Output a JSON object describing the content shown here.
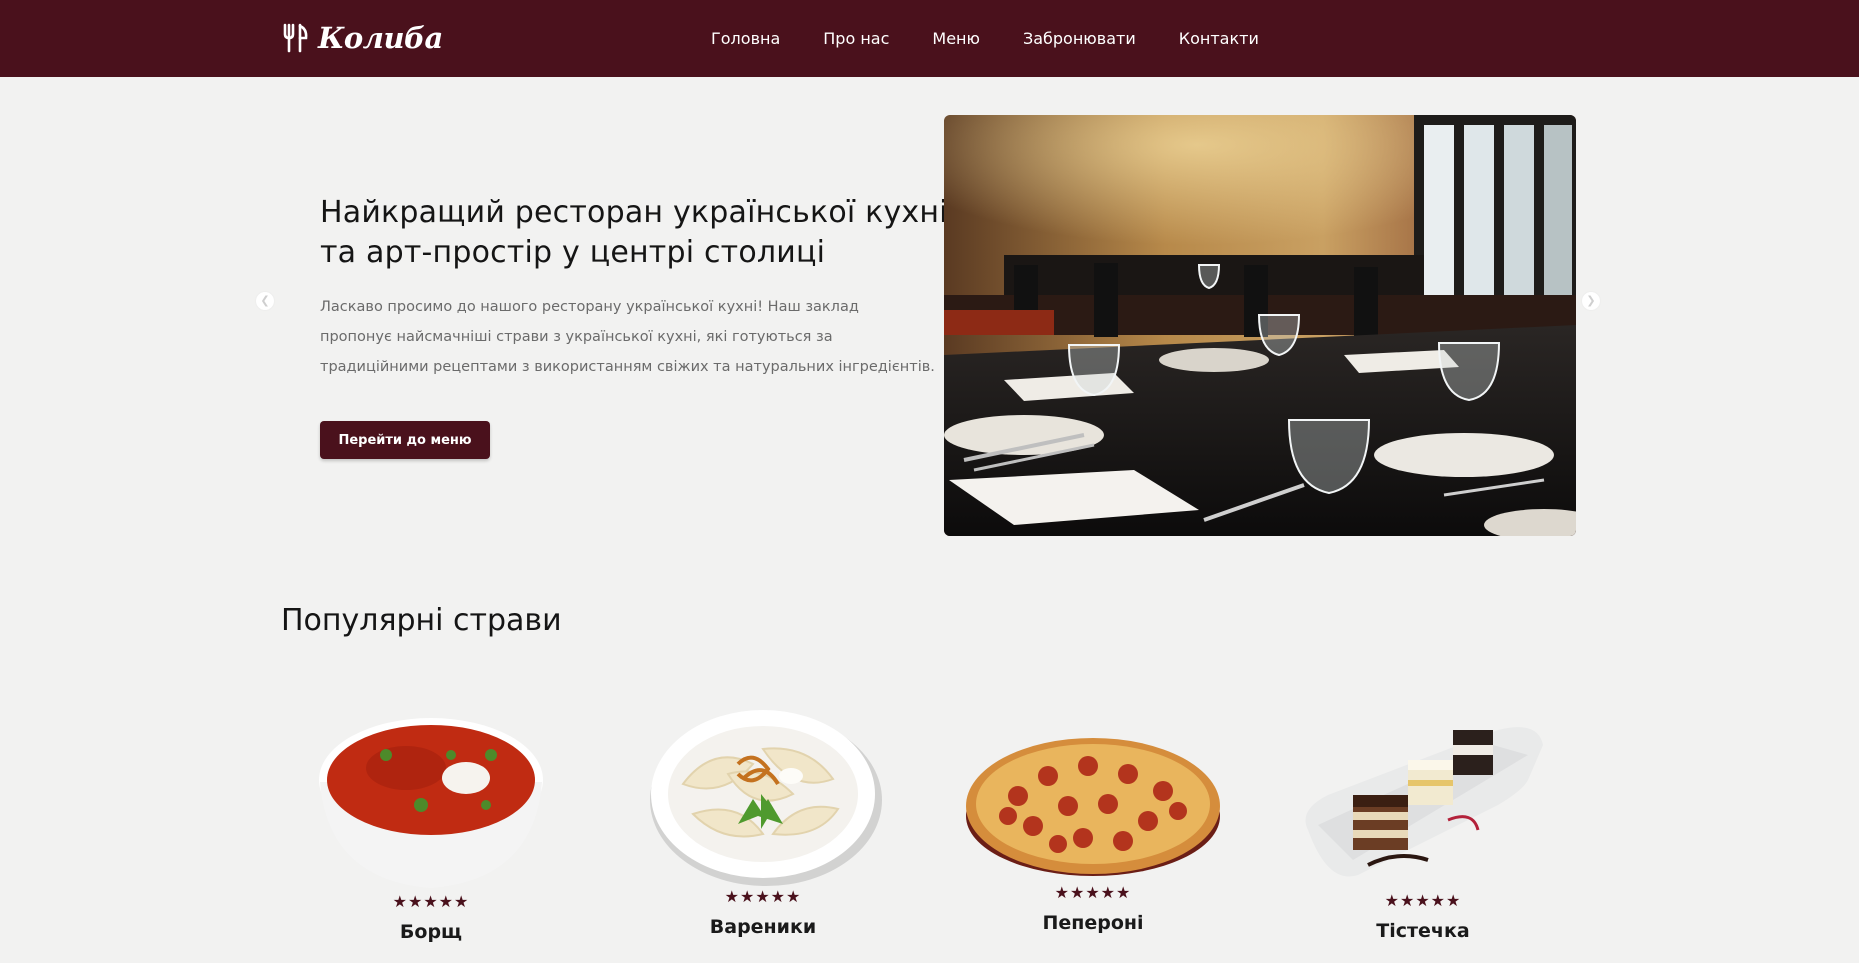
{
  "brand": {
    "name": "Колиба",
    "logo_icon": "fork-knife-icon",
    "primary_color": "#4a111c",
    "background_color": "#f2f2f1"
  },
  "nav": {
    "items": [
      {
        "label": "Головна"
      },
      {
        "label": "Про нас"
      },
      {
        "label": "Меню"
      },
      {
        "label": "Забронювати"
      },
      {
        "label": "Контакти"
      }
    ]
  },
  "hero": {
    "title_line1": "Найкращий ресторан української кухні",
    "title_line2": "та арт-простір у центрі столиці",
    "desc_line1": "Ласкаво просимо до нашого ресторану української кухні! Наш заклад",
    "desc_line2": "пропонує найсмачніші страви з української кухні, які готуються за",
    "desc_line3": "традиційними рецептами з використанням свіжих та натуральних інгредієнтів.",
    "cta_label": "Перейти до меню",
    "prev_icon": "chevron-left-icon",
    "next_icon": "chevron-right-icon"
  },
  "popular": {
    "title": "Популярні страви",
    "dishes": [
      {
        "name": "Борщ",
        "rating": 5,
        "stars": "★★★★★"
      },
      {
        "name": "Вареники",
        "rating": 5,
        "stars": "★★★★★"
      },
      {
        "name": "Пепероні",
        "rating": 5,
        "stars": "★★★★★"
      },
      {
        "name": "Тістечка",
        "rating": 5,
        "stars": "★★★★★"
      }
    ]
  }
}
